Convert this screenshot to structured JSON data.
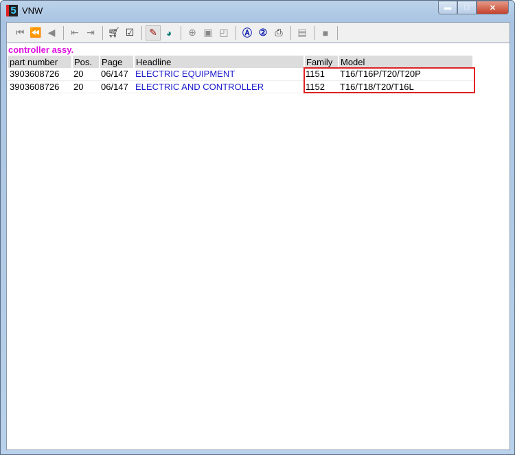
{
  "window": {
    "title": "VNW",
    "logo_text": "5"
  },
  "toolbar": {
    "buttons": [
      "first-icon",
      "rewind-icon",
      "previous-icon",
      "export-left-icon",
      "export-right-icon",
      "cart-icon",
      "checklist-icon",
      "tag-icon",
      "clock-icon",
      "zoom-in-icon",
      "page-icon",
      "page-corner-icon",
      "search-a-icon",
      "search-2-icon",
      "print-icon",
      "notes-icon",
      "stop-icon"
    ]
  },
  "caption": "controller assy.",
  "table": {
    "headers": [
      "part number",
      "Pos.",
      "Page",
      "Headline",
      "Family",
      "Model"
    ],
    "rows": [
      [
        "3903608726",
        "20",
        "06/147",
        "ELECTRIC EQUIPMENT",
        "1151",
        "T16/T16P/T20/T20P"
      ],
      [
        "3903608726",
        "20",
        "06/147",
        "ELECTRIC AND CONTROLLER",
        "1152",
        "T16/T18/T20/T16L"
      ]
    ]
  },
  "colors": {
    "caption": "#e010e0",
    "link": "#1a1acc",
    "highlight": "#e02020"
  }
}
